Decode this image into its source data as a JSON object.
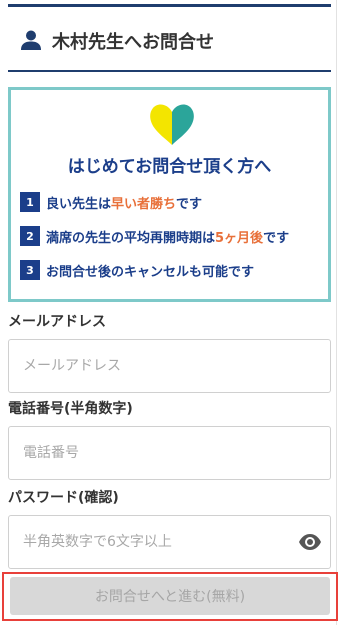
{
  "header": {
    "title": "木村先生へお問合せ",
    "icon": "user-icon",
    "accent_color": "#1f3d6e"
  },
  "banner": {
    "title": "はじめてお問合せ頂く方へ",
    "icon": "heart-icon",
    "heart_colors": [
      "#f3e500",
      "#2ba59a"
    ],
    "border_color": "#7ec9c9",
    "text_color": "#1b3e8a",
    "highlight_color": "#e8703a",
    "points": [
      {
        "num": "1",
        "pre": "良い先生は",
        "hl": "早い者勝ち",
        "post": "です"
      },
      {
        "num": "2",
        "pre": "満席の先生の平均再開時期は",
        "hl": "5ヶ月後",
        "post": "です"
      },
      {
        "num": "3",
        "pre": "お問合せ後のキャンセルも可能です",
        "hl": "",
        "post": ""
      }
    ]
  },
  "form": {
    "email": {
      "label": "メールアドレス",
      "placeholder": "メールアドレス",
      "value": ""
    },
    "phone": {
      "label": "電話番号(半角数字)",
      "placeholder": "電話番号",
      "value": ""
    },
    "password": {
      "label": "パスワード(確認)",
      "placeholder": "半角英数字で6文字以上",
      "value": "",
      "toggle_icon": "eye-icon"
    },
    "submit_label": "お問合せへと進む(無料)",
    "submit_frame_color": "#e8403a"
  }
}
